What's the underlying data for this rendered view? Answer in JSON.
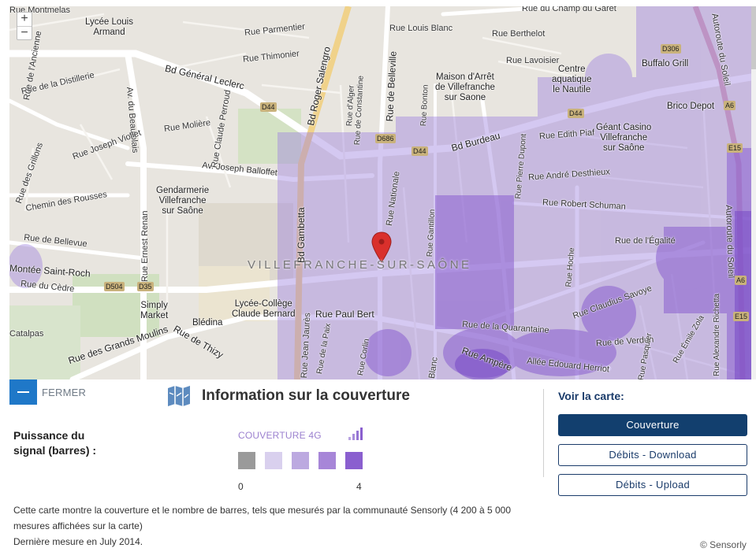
{
  "map": {
    "zoom_in": "+",
    "zoom_out": "−",
    "city_label": "VILLEFRANCHE-SUR-SAÔNE",
    "streets": {
      "montmelas": "Rue Montmelas",
      "champ_du_garet": "Rue du Champ du Garet",
      "parmentier": "Rue Parmentier",
      "louis_blanc_top": "Rue Louis Blanc",
      "berthelot": "Rue Berthelot",
      "thimonier": "Rue Thimonier",
      "lavoisier": "Rue Lavoisier",
      "bd_general_leclerc": "Bd Général Leclerc",
      "distillerie": "Rue de la Distillerie",
      "ancienne": "Rue de l'Ancienne",
      "av_beaujolais": "Av. du Beaujolais",
      "joseph_viollet": "Rue Joseph Viollet",
      "moliere": "Rue Molière",
      "claude_perroud": "Rue Claude Perroud",
      "roger_salengro": "Bd Roger Salengro",
      "belleville": "Rue de Belleville",
      "constantine": "Rue de Constantine",
      "alger": "Rue d'Alger",
      "bonton": "Rue Bonton",
      "bd_burdeau": "Bd Burdeau",
      "edith_piaf": "Rue Edith Piaf",
      "andre_desthieux": "Rue André Desthieux",
      "pierre_dupont": "Rue Pierre Dupont",
      "grillons": "Rue des Grillons",
      "av_joseph_balloffet": "Av. Joseph Balloffet",
      "chemin_rousses": "Chemin des Rousses",
      "bd_gambetta": "Bd Gambetta",
      "nationale": "Rue Nationale",
      "gantillon": "Rue Gantillon",
      "robert_schuman": "Rue Robert Schuman",
      "bellevue": "Rue de Bellevue",
      "ernest_renan": "Rue Ernest Renan",
      "egalite": "Rue de l'Égalité",
      "saint_roch": "Montée Saint-Roch",
      "cedre": "Rue du Cèdre",
      "hoche": "Rue Hoche",
      "claudius_savoye": "Rue Claudius Savoye",
      "paul_bert": "Rue Paul Bert",
      "catalpas": "Catalpas",
      "grands_moulins": "Rue des Grands Moulins",
      "thizy": "Rue de Thizy",
      "jean_jaures": "Rue Jean Jaurès",
      "de_la_paix": "Rue de la Paix",
      "corlin": "Rue Corlin",
      "blanc": "Blanc",
      "quarantaine": "Rue de la Quarantaine",
      "ampere": "Rue Ampère",
      "edouard_herriot": "Allée Edouard Herriot",
      "verdun": "Rue de Verdun",
      "pasquier": "Rue Pasquier",
      "emile_zola": "Rue Émile Zola",
      "alexandre_richetta": "Rue Alexandre Richetta",
      "autoroute_top": "Autoroute du Soleil",
      "autoroute_mid": "Autoroute du Soleil"
    },
    "roads": {
      "d44_a": "D44",
      "d44_b": "D44",
      "d44_c": "D44",
      "d686": "D686",
      "d306": "D306",
      "d504": "D504",
      "d35": "D35",
      "a6_a": "A6",
      "a6_b": "A6",
      "e15_a": "E15",
      "e15_b": "E15"
    },
    "pois": {
      "lycee_armand": "Lycée Louis\nArmand",
      "maison_arret": "Maison d'Arrêt\nde Villefranche\nsur Saone",
      "centre_aquatique": "Centre\naquatique\nle Nautile",
      "buffalo_grill": "Buffalo Grill",
      "brico_depot": "Brico Depot",
      "geant_casino": "Géant Casino\nVillefranche\nsur Saône",
      "gendarmerie": "Gendarmerie\nVillefranche\nsur Saône",
      "simply_market": "Simply\nMarket",
      "lycee_college": "Lycée-Collège\nClaude Bernard",
      "bledina": "Blédina"
    }
  },
  "panel": {
    "close_label": "FERMER",
    "title": "Information sur la couverture",
    "signal_label": "Puissance du signal (barres) :",
    "coverage_title": "COUVERTURE 4G",
    "scale_min": "0",
    "scale_max": "4",
    "swatch_colors": [
      "#9a9a9a",
      "#d9d0ee",
      "#bca9e0",
      "#a786d8",
      "#8a5fcf"
    ],
    "description_1": "Cette carte montre la couverture et le nombre de barres, tels que mesurés par la communauté Sensorly (4 200 à 5 000 mesures affichées sur la carte)",
    "description_2": "Dernière mesure en July 2014.",
    "voir_label": "Voir la carte:",
    "btn_couverture": "Couverture",
    "btn_download": "Débits - Download",
    "btn_upload": "Débits - Upload",
    "copyright": "© Sensorly"
  },
  "colors": {
    "accent_blue": "#1f78c8",
    "navy": "#123f6e",
    "coverage_purple": "#8a5fcf"
  }
}
